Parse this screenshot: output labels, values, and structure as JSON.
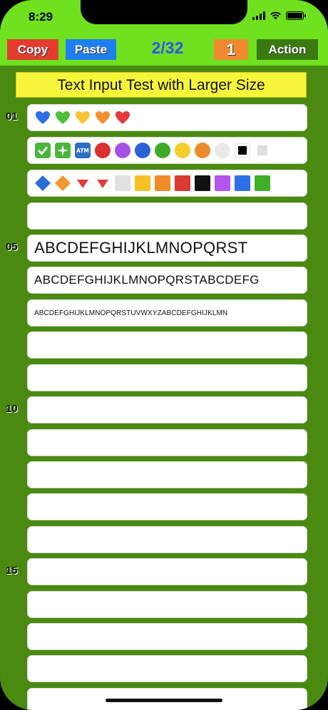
{
  "status": {
    "time": "8:29"
  },
  "toolbar": {
    "copy_label": "Copy",
    "paste_label": "Paste",
    "page_indicator": "2/32",
    "counter_label": "1",
    "action_label": "Action"
  },
  "title": "Text Input Test with Larger Size",
  "row_numbers": [
    "01",
    "05",
    "10",
    "15"
  ],
  "fields": {
    "row5": "ABCDEFGHIJKLMNOPQRST",
    "row6": "ABCDEFGHIJKLMNOPQRSTABCDEFG",
    "row7": "ABCDEFGHIJKLMNOPQRSTUVWXYZABCDEFGHIJKLMN"
  },
  "glyph_rows": {
    "row1": [
      "blue-heart-icon",
      "green-heart-icon",
      "yellow-heart-icon",
      "orange-heart-icon",
      "red-heart-icon"
    ],
    "row2": [
      "check-box-icon",
      "sparkle-box-icon",
      "atm-sign-icon",
      "red-circle-icon",
      "purple-circle-icon",
      "blue-circle-icon",
      "green-circle-icon",
      "yellow-circle-icon",
      "orange-circle-icon",
      "white-circle-icon",
      "black-square-icon",
      "white-small-square-icon"
    ],
    "row3": [
      "blue-diamond-icon",
      "orange-diamond-icon",
      "red-triangle-down-icon",
      "red-triangle-down-small-icon",
      "white-square-icon",
      "yellow-square-icon",
      "orange-square-icon",
      "red-square-icon",
      "black-square-icon",
      "purple-square-icon",
      "blue-square-icon",
      "green-square-icon"
    ]
  },
  "colors": {
    "header_bg": "#6fe11f",
    "page_bg": "#4a8a10",
    "copy_bg": "#e53b2f",
    "paste_bg": "#1f7ef0",
    "counter_bg": "#f08a30",
    "action_bg": "#3b7a10",
    "page_indicator": "#2d55f0",
    "title_bg": "#f6f53a"
  }
}
